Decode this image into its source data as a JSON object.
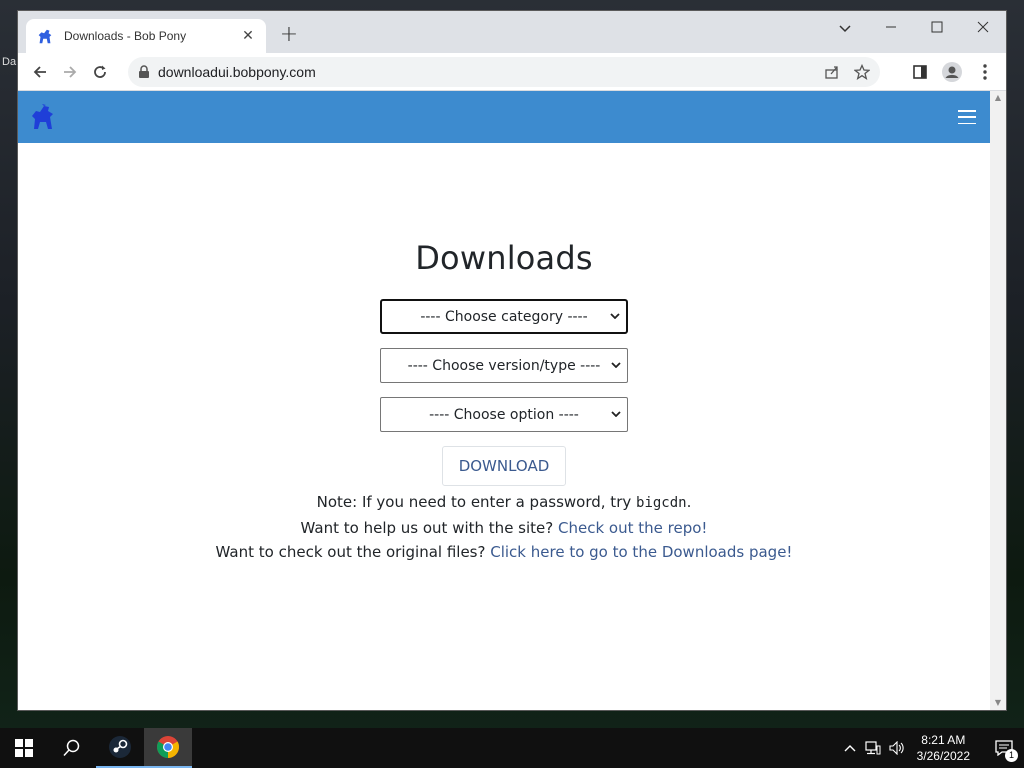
{
  "desktop": {
    "icon_label": "Da"
  },
  "browser": {
    "tab_title": "Downloads - Bob Pony",
    "url": "downloadui.bobpony.com",
    "new_tab_symbol": "+",
    "tab_close_symbol": "✕"
  },
  "page": {
    "heading": "Downloads",
    "selects": {
      "category": "---- Choose category ----",
      "version": "---- Choose version/type ----",
      "option": "---- Choose option ----"
    },
    "download_label": "DOWNLOAD",
    "note_prefix": "Note: If you need to enter a password, try ",
    "note_code": "bigcdn",
    "note_suffix": ".",
    "help_prefix": "Want to help us out with the site? ",
    "help_link": "Check out the repo!",
    "files_prefix": "Want to check out the original files? ",
    "files_link": "Click here to go to the Downloads page!"
  },
  "taskbar": {
    "time": "8:21 AM",
    "date": "3/26/2022",
    "notification_count": "1"
  },
  "colors": {
    "navbar": "#3d8bcf",
    "link": "#3b5a8f"
  }
}
